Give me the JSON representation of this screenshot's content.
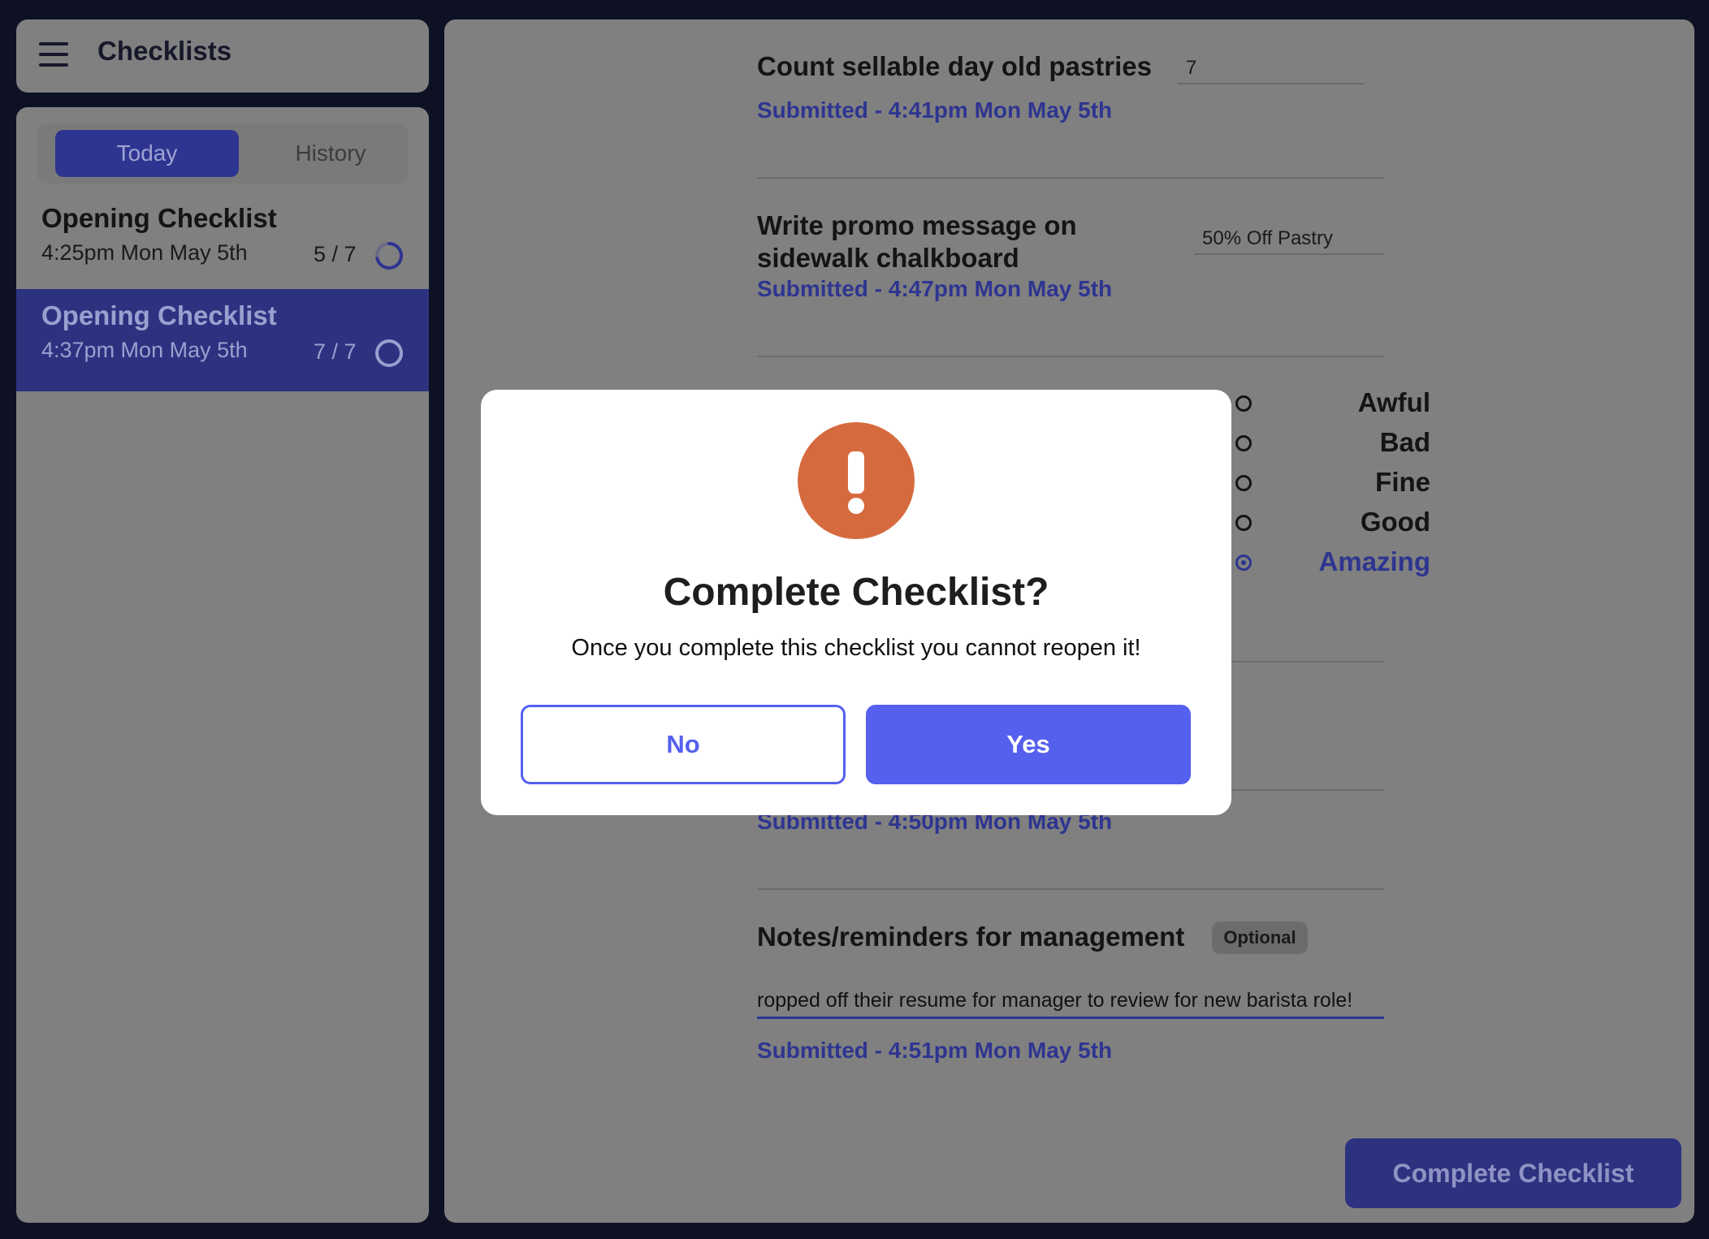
{
  "header": {
    "title": "Checklists",
    "menu_icon": "hamburger-menu-icon"
  },
  "tabs": [
    {
      "label": "Today",
      "active": true
    },
    {
      "label": "History",
      "active": false
    }
  ],
  "checklists": [
    {
      "title": "Opening Checklist",
      "time": "4:25pm Mon May 5th",
      "progress": "5 / 7",
      "completed": 5,
      "total": 7,
      "selected": false
    },
    {
      "title": "Opening Checklist",
      "time": "4:37pm Mon May 5th",
      "progress": "7 / 7",
      "completed": 7,
      "total": 7,
      "selected": true
    }
  ],
  "tasks": {
    "pastries": {
      "label": "Count sellable day old pastries",
      "value": "7",
      "submitted": "Submitted - 4:41pm Mon May 5th"
    },
    "promo": {
      "label_line1": "Write promo message on",
      "label_line2": "sidewalk chalkboard",
      "value": "50% Off Pastry",
      "submitted": "Submitted - 4:47pm Mon May 5th"
    },
    "rating": {
      "options": [
        "Awful",
        "Bad",
        "Fine",
        "Good",
        "Amazing"
      ],
      "selected": "Amazing"
    },
    "hidden_task": {
      "submitted": "Submitted - 4:50pm Mon May 5th"
    },
    "notes": {
      "label": "Notes/reminders for management",
      "badge": "Optional",
      "value": "ropped off their resume for manager to review for new barista role!",
      "submitted": "Submitted - 4:51pm Mon May 5th"
    }
  },
  "complete_button": {
    "label": "Complete Checklist"
  },
  "modal": {
    "icon": "exclamation-alert-icon",
    "title": "Complete Checklist?",
    "message": "Once you complete this checklist you cannot reopen it!",
    "no_label": "No",
    "yes_label": "Yes"
  },
  "colors": {
    "accent": "#5560ee",
    "accent_dark": "#2e3590",
    "alert": "#d66a3f",
    "background": "#0e1124",
    "overlay_panel": "#808080"
  }
}
